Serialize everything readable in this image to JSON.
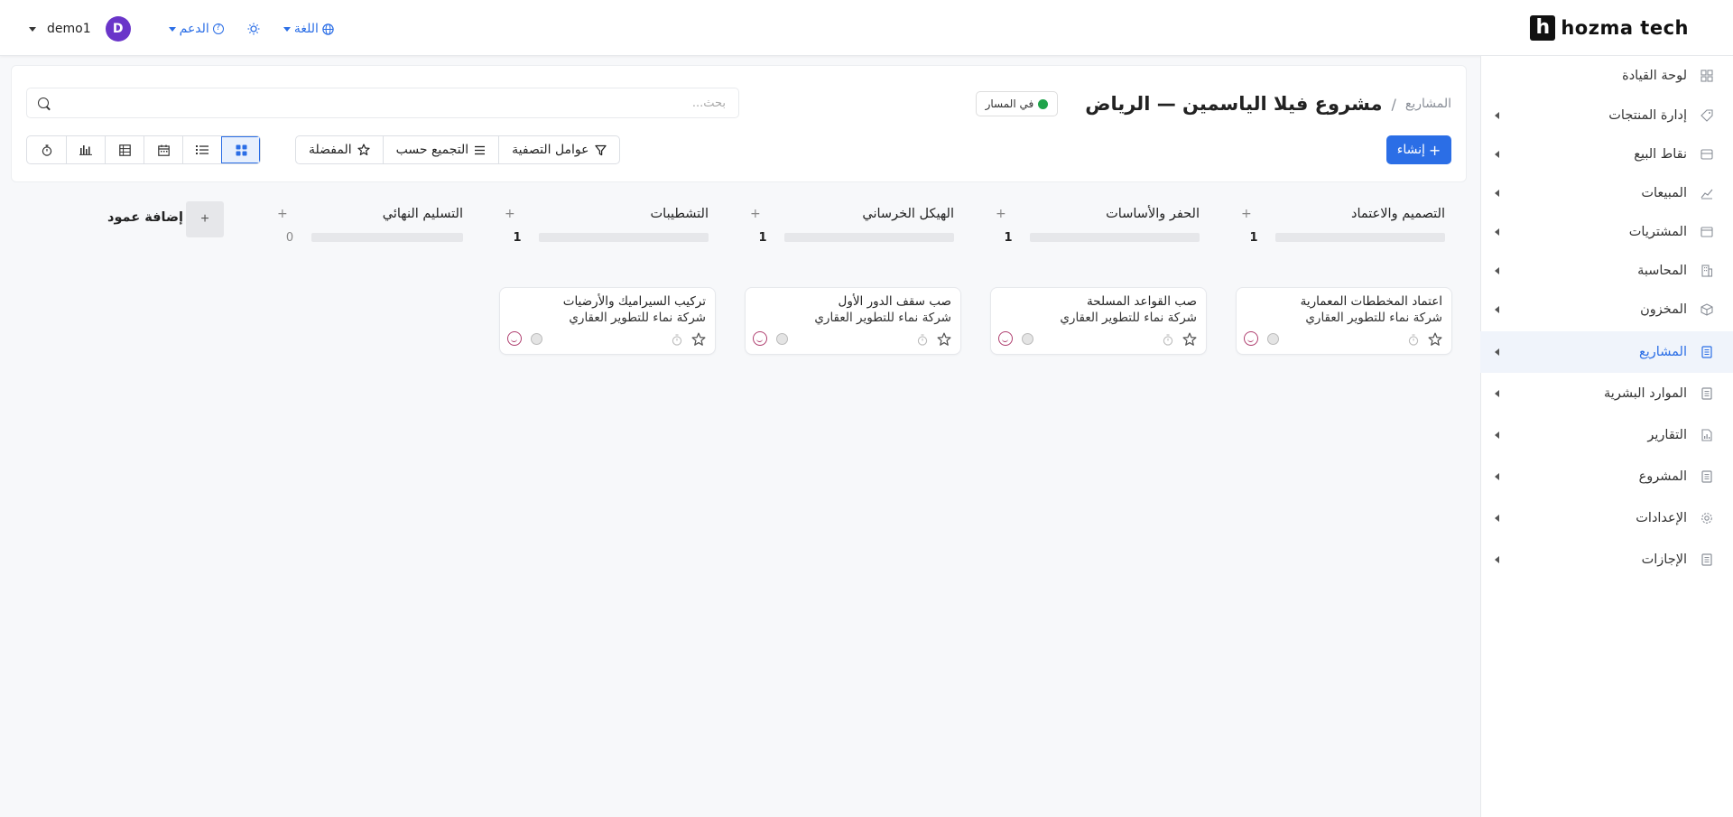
{
  "brand": {
    "mark": "h",
    "name": "hozma tech"
  },
  "topbar": {
    "user_name": "demo1",
    "avatar_initial": "D",
    "support_label": "الدعم",
    "language_label": "اللغة"
  },
  "sidebar": {
    "items": [
      {
        "label": "لوحة القيادة",
        "icon": "dashboard-icon",
        "has_arrow": false,
        "active": false
      },
      {
        "label": "إدارة المنتجات",
        "icon": "tag-icon",
        "has_arrow": true,
        "active": false
      },
      {
        "label": "نقاط البيع",
        "icon": "store-icon",
        "has_arrow": true,
        "active": false
      },
      {
        "label": "المبيعات",
        "icon": "chart-line-icon",
        "has_arrow": true,
        "active": false
      },
      {
        "label": "المشتريات",
        "icon": "wallet-icon",
        "has_arrow": true,
        "active": false
      },
      {
        "label": "المحاسبة",
        "icon": "building-icon",
        "has_arrow": true,
        "active": false
      },
      {
        "label": "المخزون",
        "icon": "box-icon",
        "has_arrow": true,
        "active": false
      },
      {
        "label": "المشاريع",
        "icon": "document-icon",
        "has_arrow": true,
        "active": true
      },
      {
        "label": "الموارد البشرية",
        "icon": "document-icon",
        "has_arrow": true,
        "active": false
      },
      {
        "label": "التقارير",
        "icon": "report-icon",
        "has_arrow": true,
        "active": false
      },
      {
        "label": "المشروع",
        "icon": "document-icon",
        "has_arrow": true,
        "active": false
      },
      {
        "label": "الإعدادات",
        "icon": "gear-icon",
        "has_arrow": true,
        "active": false
      },
      {
        "label": "الإجازات",
        "icon": "document-icon",
        "has_arrow": true,
        "active": false
      }
    ]
  },
  "header": {
    "breadcrumb_parent": "المشاريع",
    "breadcrumb_sep": "/",
    "title": "مشروع فيلا الياسمين — الرياض",
    "status_label": "في المسار",
    "status_color": "#1fa34a",
    "search_placeholder": "بحث..."
  },
  "toolbar": {
    "create_label": "إنشاء",
    "filters_label": "عوامل التصفية",
    "group_by_label": "التجميع حسب",
    "favorites_label": "المفضلة"
  },
  "kanban": {
    "columns": [
      {
        "title": "التصميم والاعتماد",
        "count": "1"
      },
      {
        "title": "الحفر والأساسات",
        "count": "1"
      },
      {
        "title": "الهيكل الخرساني",
        "count": "1"
      },
      {
        "title": "التشطيبات",
        "count": "1"
      },
      {
        "title": "التسليم النهائي",
        "count": "0"
      }
    ],
    "cards": [
      {
        "title": "اعتماد المخططات المعمارية",
        "customer": "شركة نماء للتطوير العقاري"
      },
      {
        "title": "صب القواعد المسلحة",
        "customer": "شركة نماء للتطوير العقاري"
      },
      {
        "title": "صب سقف الدور الأول",
        "customer": "شركة نماء للتطوير العقاري"
      },
      {
        "title": "تركيب السيراميك والأرضيات",
        "customer": "شركة نماء للتطوير العقاري"
      }
    ],
    "add_column_label": "إضافة عمود",
    "add_symbol": "+"
  },
  "colors": {
    "accent": "#2b6ee6",
    "avatar": "#6a35c9"
  }
}
